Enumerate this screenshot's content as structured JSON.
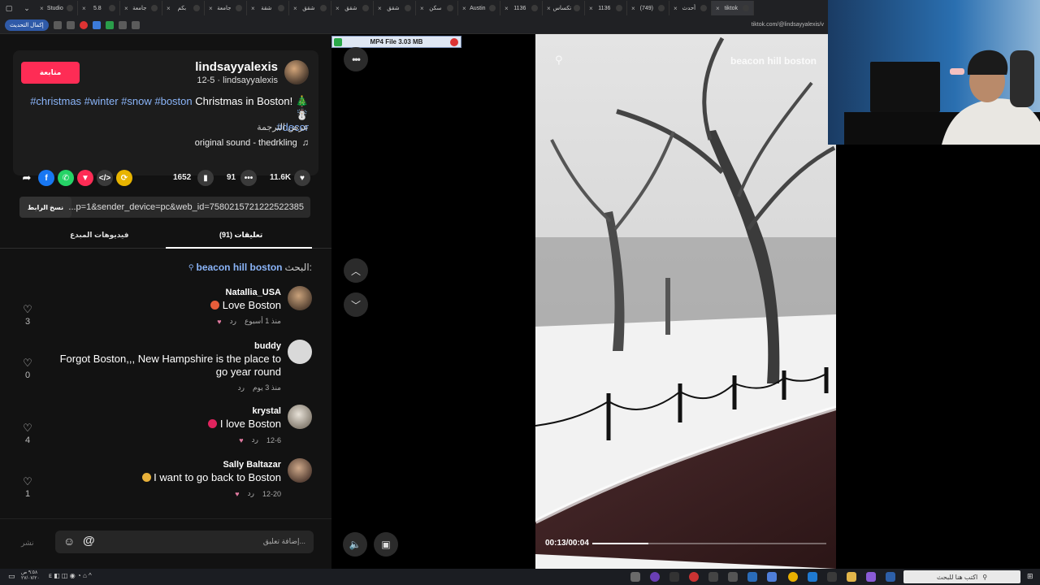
{
  "browser": {
    "tabs": [
      "Studio",
      "5.8",
      "جامعة",
      "بكم",
      "جامعة",
      "شقة",
      "شقق",
      "شقق",
      "شقق",
      "سكن",
      "Austin",
      "1136",
      "تكساس",
      "1136",
      "(749)",
      "أحدث",
      "tiktok"
    ],
    "update_label": "إكمال التحديث",
    "url": "tiktok.com/@lindsayyalexis/v"
  },
  "post": {
    "follow_label": "متابعة",
    "username": "lindsayyalexis",
    "subline": "12-5 · lindsayyalexis",
    "caption_text": "Christmas in Boston! 🎄☃️",
    "caption_tags": "#christmas #winter #snow #boston",
    "caption_tag_line2": "#decor",
    "translate_label": "عرض الترجمة",
    "sound": "original sound - thedrkling"
  },
  "actions": {
    "likes": "11.6K",
    "comments": "91",
    "saves": "1652"
  },
  "link": {
    "copy_label": "نسخ الرابط",
    "url_text": "...p=1&sender_device=pc&web_id=7580215721222522385"
  },
  "tabs": {
    "comments_label": "تعليقات (91)",
    "creator_videos_label": "فيديوهات المبدع"
  },
  "search": {
    "prefix": "البحث:",
    "query": "beacon hill boston"
  },
  "comments": [
    {
      "name": "Natallia_USA",
      "text": "Love Boston",
      "time": "منذ 1 أسبوع",
      "reply": "رد",
      "likes": "3",
      "emoji_color": "#e85d3a"
    },
    {
      "name": "buddy",
      "text": "Forgot Boston,,, New Hampshire is the place to go year round",
      "time": "منذ 3 يوم",
      "reply": "رد",
      "likes": "0"
    },
    {
      "name": "krystal",
      "text": "I love Boston",
      "time": "12-6",
      "reply": "رد",
      "likes": "4",
      "emoji_color": "#e0245e"
    },
    {
      "name": "Sally Baltazar",
      "text": "I want to go back to Boston",
      "time": "12-20",
      "reply": "رد",
      "likes": "1",
      "emoji_color": "#e8b13a"
    }
  ],
  "comment_input": {
    "placeholder": "إضافة تعليق...",
    "post_label": "نشر"
  },
  "download_bar": {
    "label": "MP4 File 3.03 MB"
  },
  "video": {
    "search_overlay": "beacon hill boston",
    "time": "00:13/00:04",
    "progress": 0.24
  },
  "taskbar": {
    "search_placeholder": "اكتب هنا للبحث",
    "clock_time": "٩:٥٨ ص",
    "clock_date": "٢٧/٠٧/٢٠"
  },
  "colors": {
    "accent": "#fe2c55",
    "link": "#8ab4f8"
  }
}
